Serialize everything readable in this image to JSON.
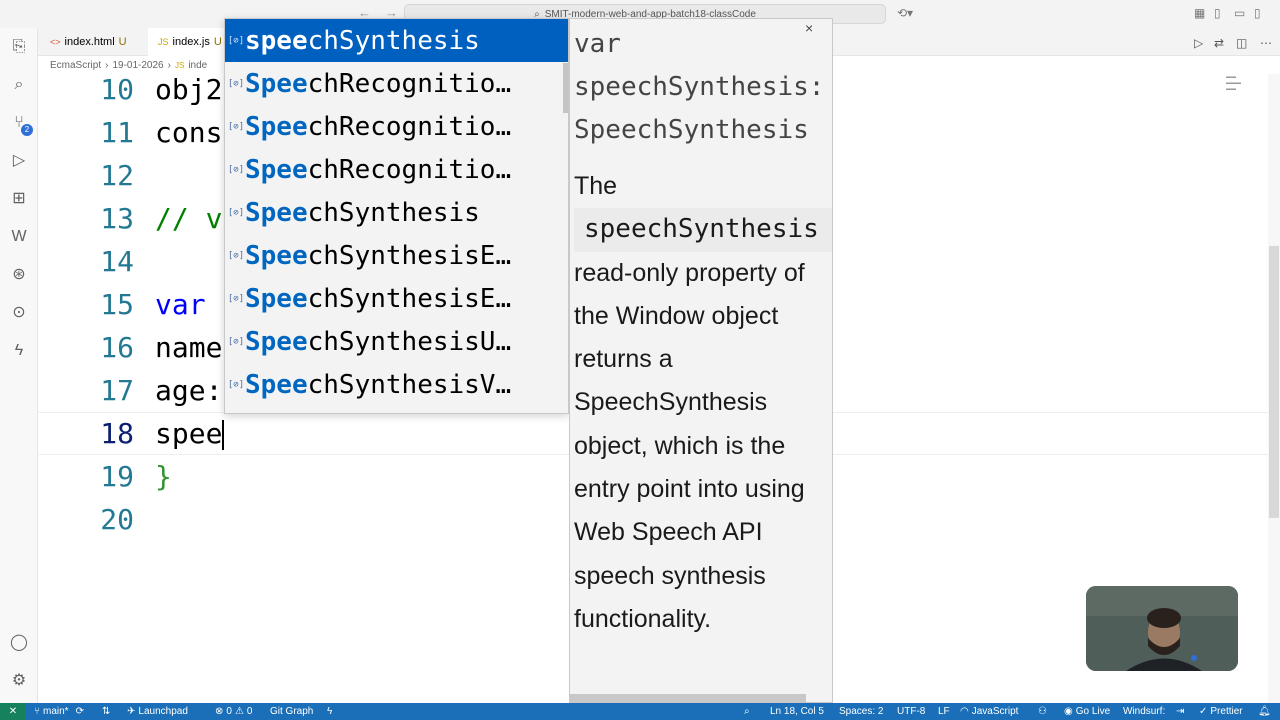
{
  "titlebar": {
    "back": "←",
    "forward": "→",
    "search_text": "SMIT-modern-web-and-app-batch18-classCode"
  },
  "tabs": [
    {
      "icon": "<>",
      "name": "index.html",
      "status": "U"
    },
    {
      "icon": "JS",
      "name": "index.js",
      "status": "U"
    }
  ],
  "breadcrumb": [
    "EcmaScript",
    "19-01-2026",
    "JS",
    "inde"
  ],
  "editor": {
    "lines": [
      {
        "num": "10",
        "text": "obj2"
      },
      {
        "num": "11",
        "text": "cons"
      },
      {
        "num": "12",
        "text": ""
      },
      {
        "num": "13",
        "text": "// v"
      },
      {
        "num": "14",
        "text": ""
      },
      {
        "num": "15",
        "kw": "var",
        "text": " "
      },
      {
        "num": "16",
        "text": "name"
      },
      {
        "num": "17",
        "text": "age:"
      },
      {
        "num": "18",
        "text": "spee"
      },
      {
        "num": "19",
        "text": "}"
      },
      {
        "num": "20",
        "text": ""
      }
    ]
  },
  "suggestions": [
    {
      "match": "spee",
      "rest": "chSynthesis"
    },
    {
      "match": "Spee",
      "rest": "chRecognitio…"
    },
    {
      "match": "Spee",
      "rest": "chRecognitio…"
    },
    {
      "match": "Spee",
      "rest": "chRecognitio…"
    },
    {
      "match": "Spee",
      "rest": "chSynthesis"
    },
    {
      "match": "Spee",
      "rest": "chSynthesisE…"
    },
    {
      "match": "Spee",
      "rest": "chSynthesisE…"
    },
    {
      "match": "Spee",
      "rest": "chSynthesisU…"
    },
    {
      "match": "Spee",
      "rest": "chSynthesisV…"
    }
  ],
  "details": {
    "signature": "var speechSynthesis: SpeechSynthesis",
    "doc_pre": "The",
    "doc_code": "speechSynthesis",
    "doc_post": "read-only property of the Window object returns a SpeechSynthesis object, which is the entry point into using Web Speech API speech synthesis functionality.",
    "close": "×"
  },
  "statusbar": {
    "remote": "✕",
    "branch": "main*",
    "launchpad": "Launchpad",
    "errors": "0",
    "warnings": "0",
    "git_graph": "Git Graph",
    "position": "Ln 18, Col 5",
    "spaces": "Spaces: 2",
    "encoding": "UTF-8",
    "eol": "LF",
    "language": "JavaScript",
    "go_live": "Go Live",
    "windsurf": "Windsurf:",
    "prettier": "Prettier"
  },
  "colors": {
    "status_bar": "#1a6fb8",
    "selection": "#0060c0",
    "keyword": "#0000ff",
    "line_number": "#237893"
  }
}
